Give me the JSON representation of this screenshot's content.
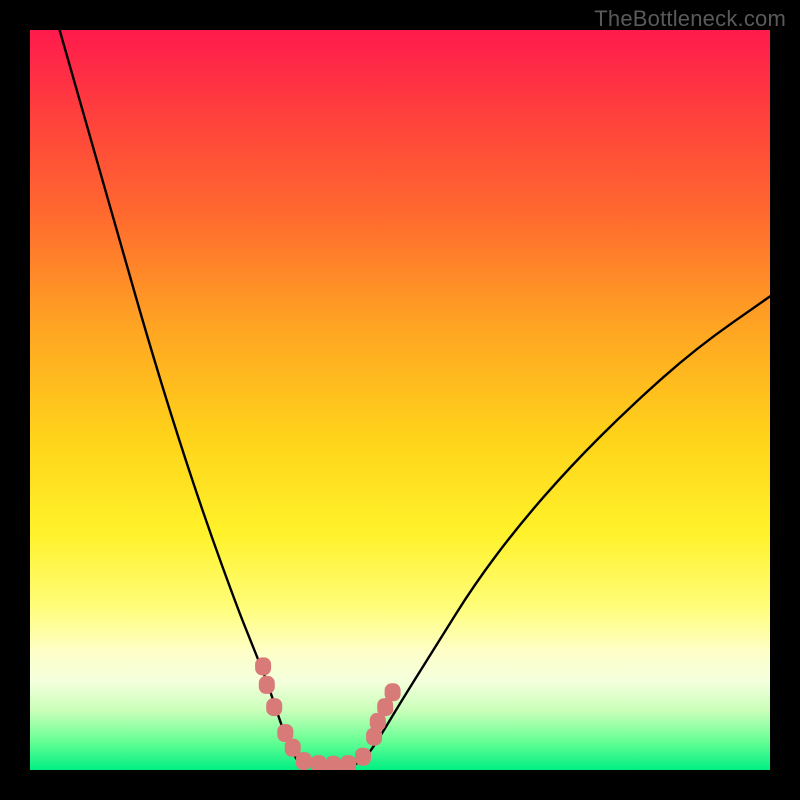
{
  "watermark": "TheBottleneck.com",
  "colors": {
    "frame": "#000000",
    "curve_stroke": "#000000",
    "marker_fill": "#d87a78",
    "gradient": [
      "#ff1a4d",
      "#ff3b3f",
      "#ff6a2e",
      "#ffa423",
      "#ffd31a",
      "#fff22a",
      "#fffd7a",
      "#feffc8",
      "#f4ffdc",
      "#c9ffb9",
      "#69ff95",
      "#00ef83"
    ]
  },
  "chart_data": {
    "type": "line",
    "title": "",
    "xlabel": "",
    "ylabel": "",
    "xlim": [
      0,
      100
    ],
    "ylim": [
      0,
      100
    ],
    "legend": false,
    "series": [
      {
        "name": "left-arm",
        "x": [
          4,
          8,
          12,
          16,
          20,
          24,
          28,
          30,
          32,
          33,
          34,
          35,
          36
        ],
        "y": [
          100,
          86,
          72,
          58,
          45,
          33,
          22,
          17,
          12,
          9,
          6,
          3.5,
          1.5
        ]
      },
      {
        "name": "valley",
        "x": [
          36,
          38,
          40,
          42,
          44,
          45
        ],
        "y": [
          1.5,
          0.8,
          0.6,
          0.6,
          0.8,
          1.2
        ]
      },
      {
        "name": "right-arm",
        "x": [
          45,
          47,
          50,
          55,
          60,
          66,
          73,
          81,
          90,
          100
        ],
        "y": [
          1.2,
          4,
          9,
          17,
          25,
          33,
          41,
          49,
          57,
          64
        ]
      }
    ],
    "markers": [
      {
        "name": "left-cluster-1",
        "x": 31.5,
        "y": 14
      },
      {
        "name": "left-cluster-2",
        "x": 32.0,
        "y": 11.5
      },
      {
        "name": "left-cluster-3",
        "x": 33.0,
        "y": 8.5
      },
      {
        "name": "left-cluster-4",
        "x": 34.5,
        "y": 5
      },
      {
        "name": "left-cluster-5",
        "x": 35.5,
        "y": 3
      },
      {
        "name": "valley-1",
        "x": 37.0,
        "y": 1.2
      },
      {
        "name": "valley-2",
        "x": 39.0,
        "y": 0.8
      },
      {
        "name": "valley-3",
        "x": 41.0,
        "y": 0.7
      },
      {
        "name": "valley-4",
        "x": 43.0,
        "y": 0.8
      },
      {
        "name": "right-cluster-1",
        "x": 45.0,
        "y": 1.8
      },
      {
        "name": "right-cluster-2",
        "x": 46.5,
        "y": 4.5
      },
      {
        "name": "right-cluster-3",
        "x": 47.0,
        "y": 6.5
      },
      {
        "name": "right-cluster-4",
        "x": 48.0,
        "y": 8.5
      },
      {
        "name": "right-cluster-5",
        "x": 49.0,
        "y": 10.5
      }
    ]
  }
}
